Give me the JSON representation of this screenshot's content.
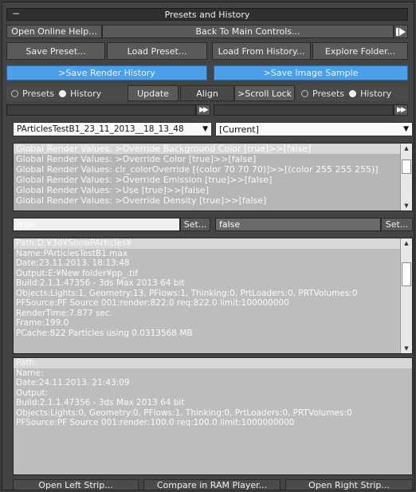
{
  "window": {
    "title": "Presets and History"
  },
  "row1": {
    "help": "Open Online Help...",
    "back": "Back To Main Controls..."
  },
  "row2": {
    "save_preset": "Save Preset...",
    "load_preset": "Load Preset...",
    "load_history": "Load From History...",
    "explore": "Explore Folder..."
  },
  "row3": {
    "save_render": ">Save Render History",
    "save_image": ">Save Image Sample"
  },
  "row4": {
    "left_presets": "Presets",
    "left_history": "History",
    "update": "Update",
    "align": "Align",
    "scroll_lock": ">Scroll Lock",
    "right_presets": "Presets",
    "right_history": "History"
  },
  "dropdowns": {
    "left": "PArticlesTestB1_23_11_2013__18_13_48",
    "right": "[Current]"
  },
  "render_values": [
    "Global Render Values: >Override Background Color [true]>>[false]",
    "Global Render Values: >Override Color [true]>>[false]",
    "Global Render Values: clr_colorOverride [(color 70 70 70)]>>[(color 255 255 255)]",
    "Global Render Values: >Override Emission [true]>>[false]",
    "Global Render Values: >Use [true]>>[false]",
    "Global Render Values: >Override Density [true]>>[false]"
  ],
  "fields": {
    "left_value": "true",
    "left_set": "Set...",
    "right_value": "false",
    "right_set": "Set..."
  },
  "info_left": [
    "Path:D:¥3d¥SnowPArticles¥",
    "Name:PArticlesTestB1.max",
    "Date:23.11.2013. 18:13:48",
    "Output:E:¥New folder¥pp_.tif",
    "Build:2.1.1.47356 - 3ds Max 2013 64 bit",
    "Objects:Lights:1, Geometry:13, PFlows:1, Thinking:0, PrtLoaders:0, PRTVolumes:0",
    "PFSource:PF Source 001:render:822.0 req:822.0 limit:100000000",
    "RenderTime:7.877 sec.",
    "Frame:199.0",
    "PCache:822 Particles using 0.0313568 MB"
  ],
  "info_right": [
    "Path:",
    "Name:",
    "Date:24.11.2013. 21:43:09",
    "Output:",
    "Build:2.1.1.47356 - 3ds Max 2013 64 bit",
    "Objects:Lights:0, Geometry:0, PFlows:1, Thinking:0, PrtLoaders:0, PRTVolumes:0",
    "PFSource:PF Source 001:render:100.0 req:100.0 limit:1000000000"
  ],
  "bottom": {
    "left_strip": "Open Left Strip...",
    "compare": "Compare in RAM Player...",
    "right_strip": "Open Right Strip..."
  },
  "colors": {
    "accent_blue": "#4a9fe8",
    "panel": "#444444"
  }
}
